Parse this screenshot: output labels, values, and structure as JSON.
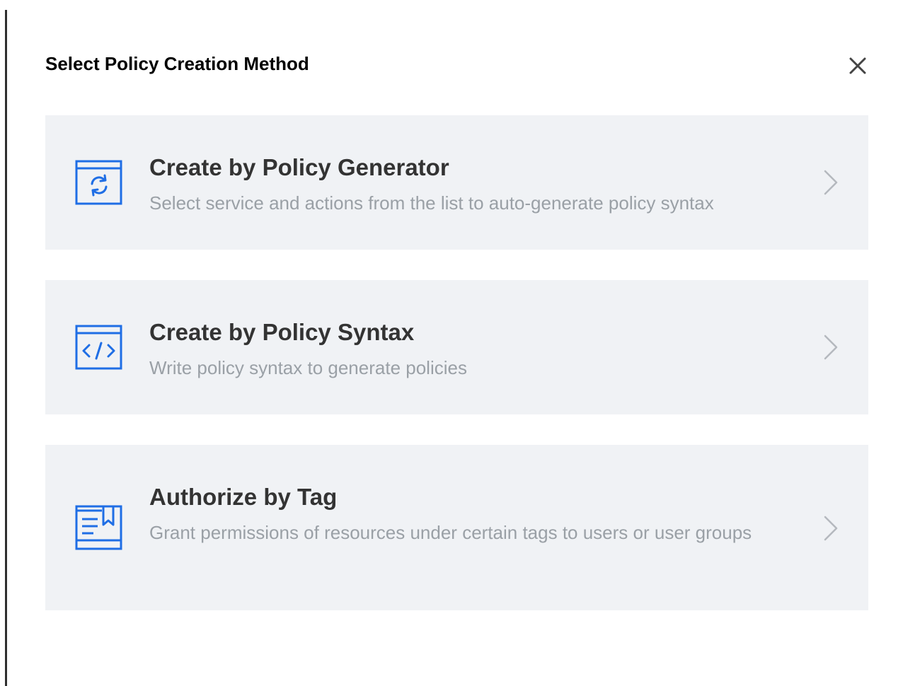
{
  "dialog": {
    "title": "Select Policy Creation Method",
    "close_icon": "close-icon",
    "accent_color": "#1f6ee5",
    "card_background": "#f0f2f5"
  },
  "options": [
    {
      "title": "Create by Policy Generator",
      "description": "Select service and actions from the list to auto-generate policy syntax",
      "icon": "policy-generator-icon"
    },
    {
      "title": "Create by Policy Syntax",
      "description": "Write policy syntax to generate policies",
      "icon": "code-icon"
    },
    {
      "title": "Authorize by Tag",
      "description": "Grant permissions of resources under certain tags to users or user groups",
      "icon": "tag-document-icon"
    }
  ]
}
